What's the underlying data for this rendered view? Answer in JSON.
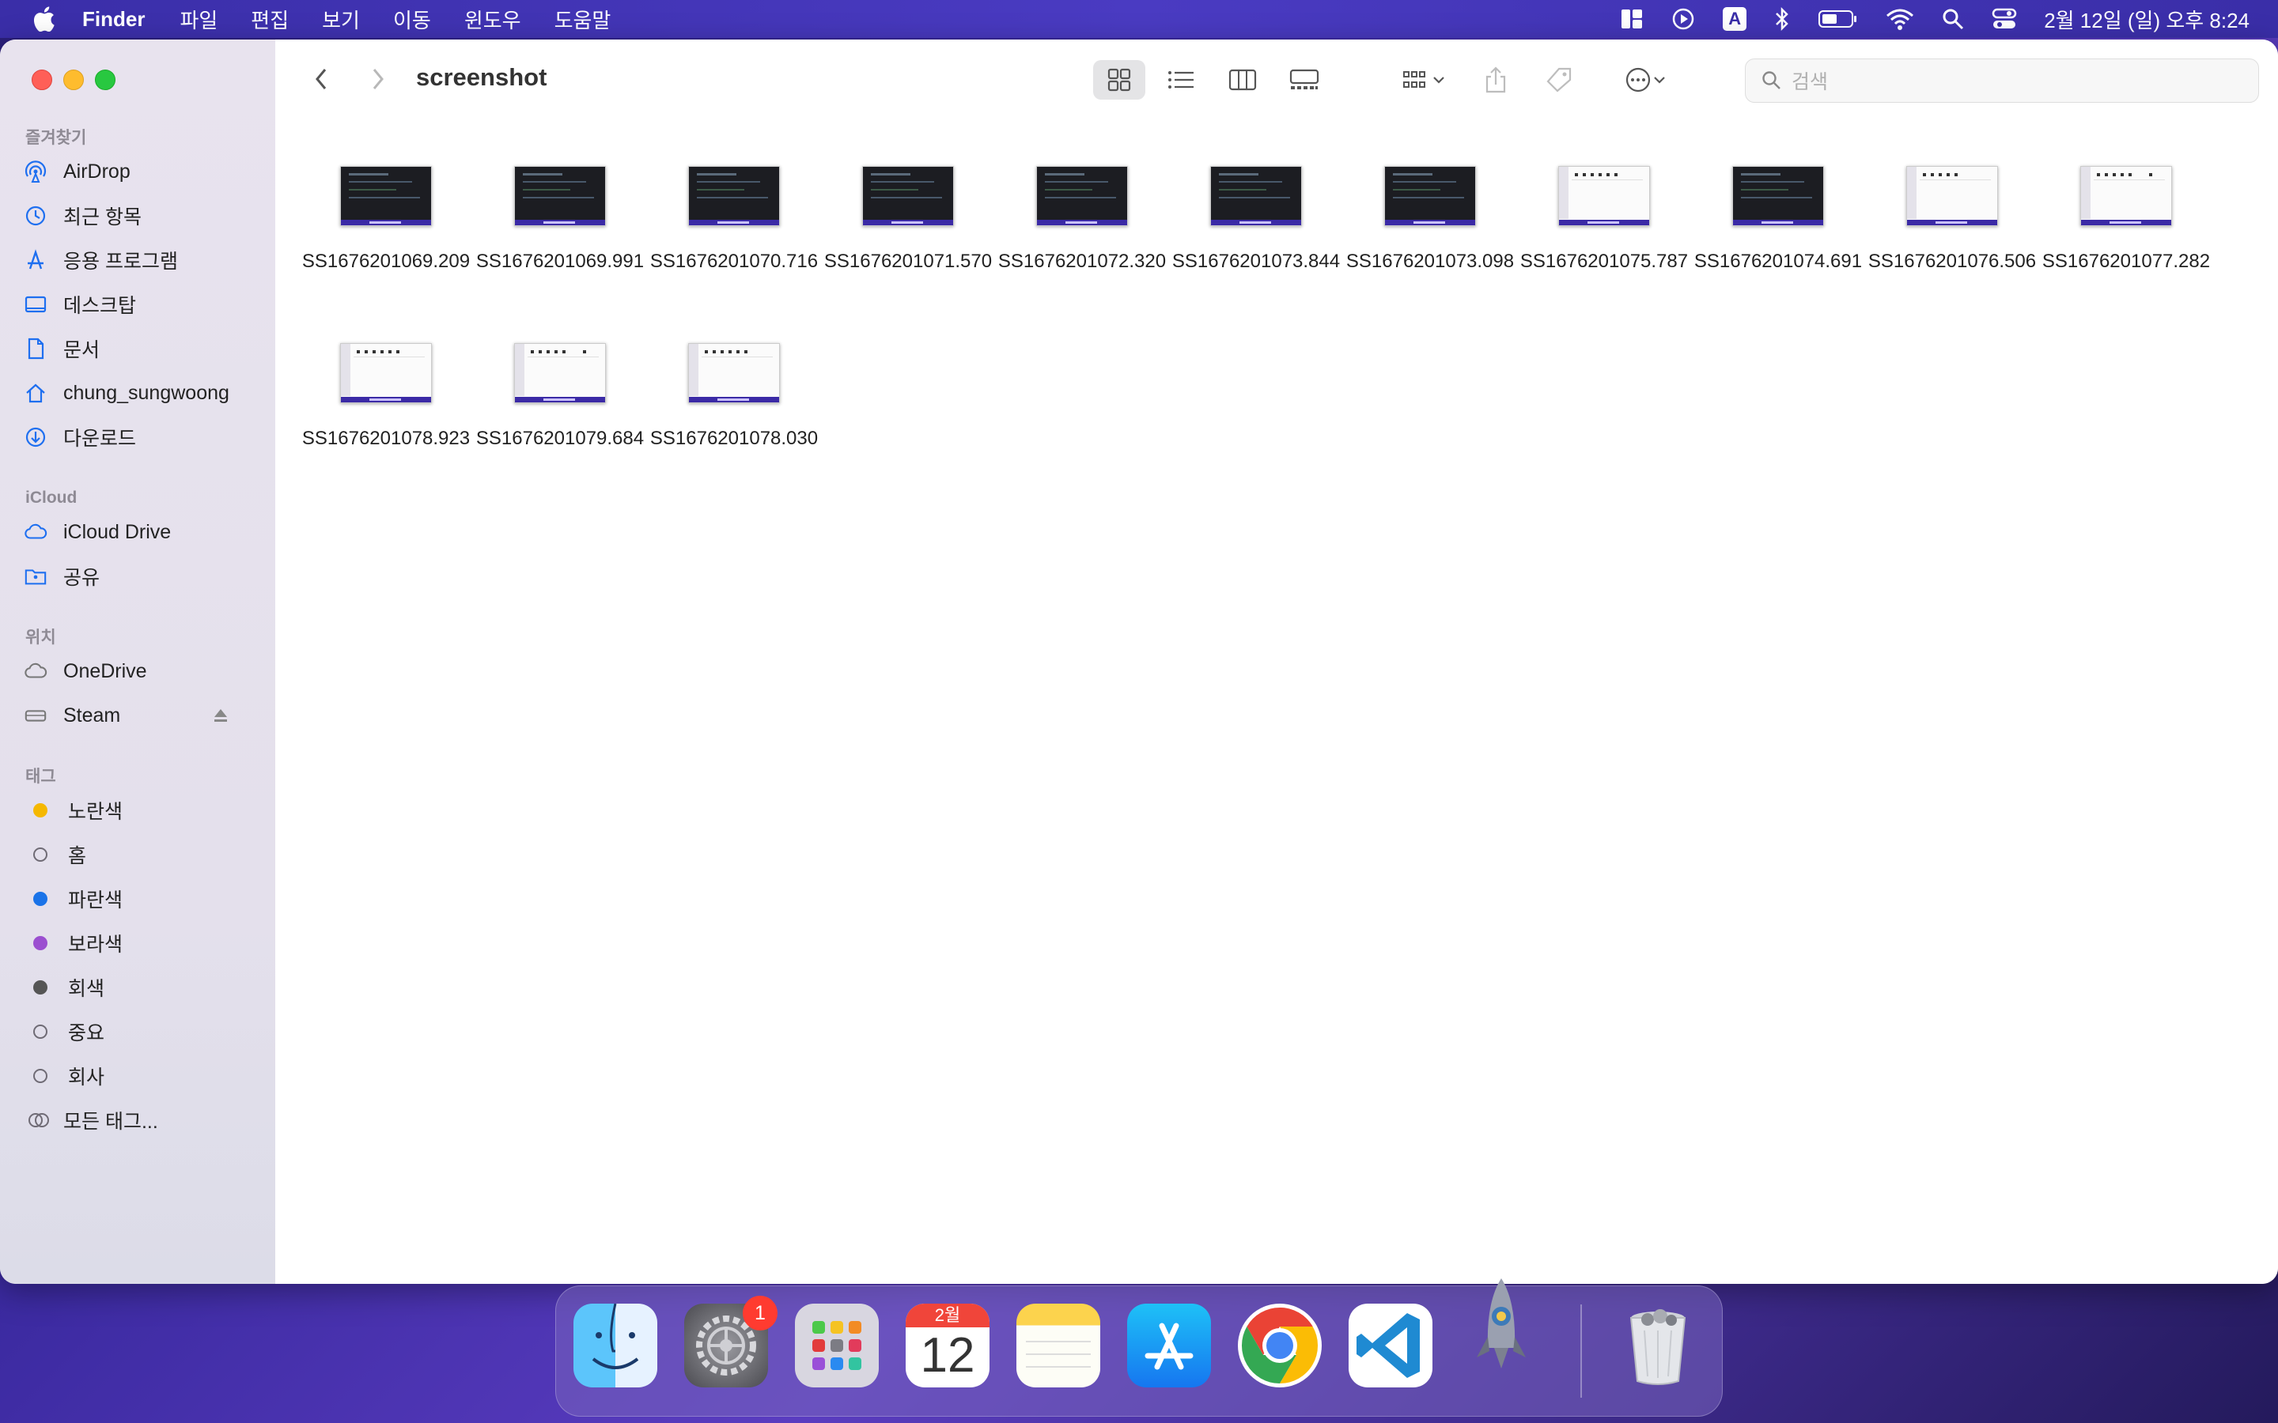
{
  "menubar": {
    "app": "Finder",
    "menus": [
      "파일",
      "편집",
      "보기",
      "이동",
      "윈도우",
      "도움말"
    ],
    "input_indicator": "A",
    "clock": "2월 12일 (일) 오후 8:24"
  },
  "window": {
    "title": "screenshot",
    "search_placeholder": "검색"
  },
  "sidebar": {
    "favorites_title": "즐겨찾기",
    "favorites": [
      {
        "label": "AirDrop",
        "icon": "airdrop-icon"
      },
      {
        "label": "최근 항목",
        "icon": "clock-icon"
      },
      {
        "label": "응용 프로그램",
        "icon": "applications-icon"
      },
      {
        "label": "데스크탑",
        "icon": "desktop-icon"
      },
      {
        "label": "문서",
        "icon": "document-icon"
      },
      {
        "label": "chung_sungwoong",
        "icon": "home-icon"
      },
      {
        "label": "다운로드",
        "icon": "download-icon"
      }
    ],
    "icloud_title": "iCloud",
    "icloud": [
      {
        "label": "iCloud Drive",
        "icon": "cloud-icon"
      },
      {
        "label": "공유",
        "icon": "shared-folder-icon"
      }
    ],
    "locations_title": "위치",
    "locations": [
      {
        "label": "OneDrive",
        "icon": "cloud-icon"
      },
      {
        "label": "Steam",
        "icon": "drive-icon"
      }
    ],
    "tags_title": "태그",
    "tags": [
      {
        "label": "노란색",
        "color": "#f5b800"
      },
      {
        "label": "홈",
        "color": "hollow"
      },
      {
        "label": "파란색",
        "color": "#1a73e8"
      },
      {
        "label": "보라색",
        "color": "#9b4fd0"
      },
      {
        "label": "회색",
        "color": "#555555"
      },
      {
        "label": "중요",
        "color": "hollow"
      },
      {
        "label": "회사",
        "color": "hollow"
      },
      {
        "label": "모든 태그...",
        "color": "all"
      }
    ]
  },
  "files": [
    {
      "name": "SS1676201069.209",
      "thumb": "dark"
    },
    {
      "name": "SS1676201069.991",
      "thumb": "dark"
    },
    {
      "name": "SS1676201070.716",
      "thumb": "dark"
    },
    {
      "name": "SS1676201071.570",
      "thumb": "dark"
    },
    {
      "name": "SS1676201072.320",
      "thumb": "dark"
    },
    {
      "name": "SS1676201073.844",
      "thumb": "dark"
    },
    {
      "name": "SS1676201073.098",
      "thumb": "dark"
    },
    {
      "name": "SS1676201075.787",
      "thumb": "light"
    },
    {
      "name": "SS1676201074.691",
      "thumb": "dark"
    },
    {
      "name": "SS1676201076.506",
      "thumb": "light"
    },
    {
      "name": "SS1676201077.282",
      "thumb": "light"
    },
    {
      "name": "SS1676201078.923",
      "thumb": "light"
    },
    {
      "name": "SS1676201079.684",
      "thumb": "light"
    },
    {
      "name": "SS1676201078.030",
      "thumb": "light"
    }
  ],
  "dock": {
    "settings_badge": "1",
    "calendar_month": "2월",
    "calendar_day": "12",
    "apps": [
      "finder",
      "system-settings",
      "launchpad",
      "calendar",
      "notes",
      "app-store",
      "chrome",
      "vscode",
      "python-launcher",
      "trash"
    ]
  }
}
